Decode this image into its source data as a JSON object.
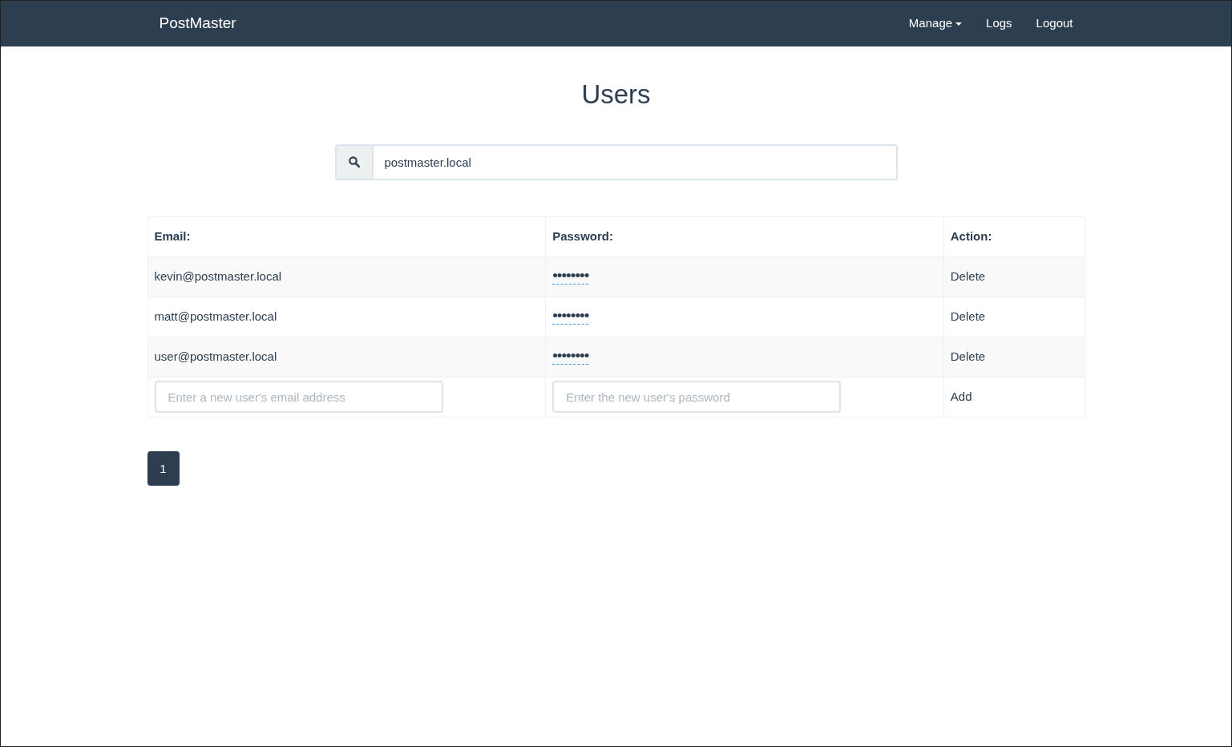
{
  "navbar": {
    "brand": "PostMaster",
    "items": [
      {
        "label": "Manage",
        "dropdown": true
      },
      {
        "label": "Logs",
        "dropdown": false
      },
      {
        "label": "Logout",
        "dropdown": false
      }
    ]
  },
  "heading": "Users",
  "search": {
    "value": "postmaster.local"
  },
  "table": {
    "columns": [
      "Email:",
      "Password:",
      "Action:"
    ],
    "rows": [
      {
        "email": "kevin@postmaster.local",
        "password": "••••••••",
        "action": "Delete"
      },
      {
        "email": "matt@postmaster.local",
        "password": "••••••••",
        "action": "Delete"
      },
      {
        "email": "user@postmaster.local",
        "password": "••••••••",
        "action": "Delete"
      }
    ],
    "new_row": {
      "email_placeholder": "Enter a new user's email address",
      "password_placeholder": "Enter the new user's password",
      "action": "Add"
    }
  },
  "pagination": [
    {
      "label": "1",
      "selected": true
    }
  ]
}
